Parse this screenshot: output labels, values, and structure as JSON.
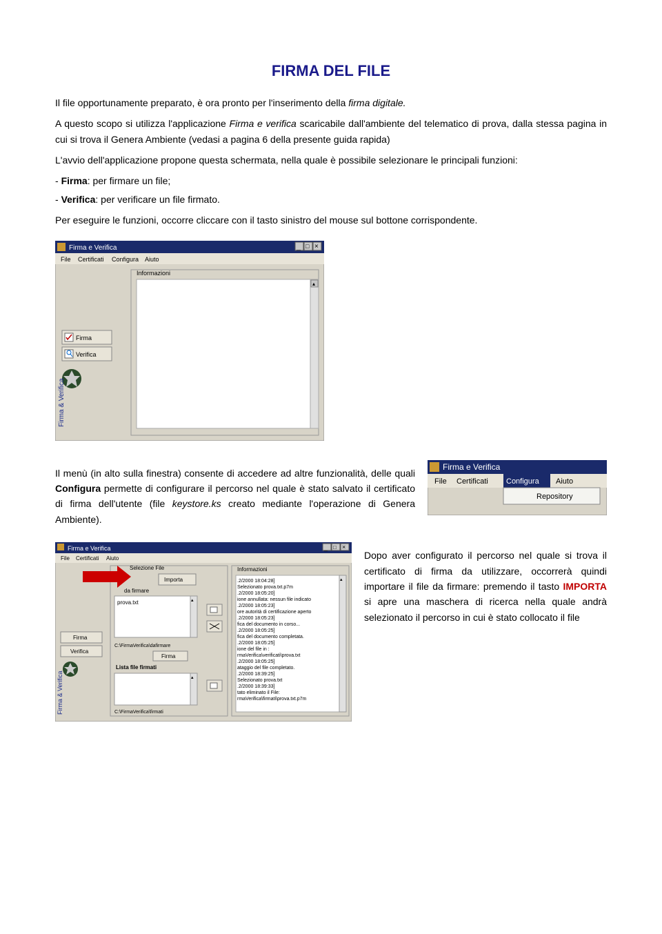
{
  "title": "FIRMA DEL FILE",
  "intro": "Il file opportunamente preparato, è ora pronto per l'inserimento della ",
  "intro_italic": "firma digitale.",
  "p1a": "A questo scopo si utilizza l'applicazione ",
  "p1_italic": "Firma e verifica",
  "p1b": " scaricabile dall'ambiente del telematico di prova, dalla stessa pagina in cui si trova il Genera Ambiente (vedasi a pagina 6 della presente guida rapida)",
  "p2": "L'avvio dell'applicazione propone questa schermata, nella quale è possibile selezionare le principali funzioni:",
  "bullet1_bold": "Firma",
  "bullet1_rest": ": per firmare un file;",
  "bullet2_bold": "Verifica",
  "bullet2_rest": ": per verificare un file firmato.",
  "p3": "Per eseguire le funzioni, occorre cliccare con il tasto sinistro del mouse sul bottone corrispondente.",
  "menu_p_a": "Il menù (in alto sulla finestra) consente di accedere ad altre funzionalità, delle quali ",
  "menu_p_bold": "Configura",
  "menu_p_b": " permette di configurare il percorso nel quale è stato salvato il certificato di firma dell'utente (file ",
  "menu_p_italic": "keystore.ks",
  "menu_p_c": " creato mediante l'operazione di Genera Ambiente).",
  "final_a": "Dopo aver configurato il percorso nel quale si trova il certificato di firma da utilizzare, occorrerà quindi importare il file da firmare: premendo il tasto ",
  "final_red": "IMPORTA",
  "final_b": " si apre una maschera di ricerca nella quale andrà selezionato il percorso in cui è stato collocato il file",
  "app_window": {
    "title": "Firma e Verifica",
    "menu": [
      "File",
      "Certificati",
      "Configura",
      "Aiuto"
    ],
    "panel": "Informazioni",
    "btn_firma": "Firma",
    "btn_verifica": "Verifica",
    "vertical_label": "Firma & Verifica"
  },
  "menu_window": {
    "title": "Firma e Verifica",
    "menu": [
      "File",
      "Certificati",
      "Configura",
      "Aiuto"
    ],
    "submenu": "Repository"
  },
  "shot2": {
    "title": "Firma e Verifica",
    "menu": [
      "File",
      "Certificati",
      "Aiuto"
    ],
    "selezione_file": "Selezione File",
    "importa": "Importa",
    "da_firmare": "da firmare",
    "file_entry": "prova.txt",
    "path1": "C:\\FirmaVerifica\\dafirmare",
    "firma_btn": "Firma",
    "lista_firmati": "Lista file firmati",
    "path2": "C:\\FirmaVerifica\\firmati",
    "btn_firma": "Firma",
    "btn_verifica": "Verifica",
    "panel": "Informazioni",
    "loglines": [
      ".2/2000 18:04:28]",
      " Selezionato prova.txt.p7m",
      ".2/2000 18:05:20]",
      "ione annullata: nessun file indicato",
      ".2/2000 18:05:23]",
      "ore autorità di certificazione aperto",
      ".2/2000 18:05:23]",
      "fica del documento in corso...",
      ".2/2000 18:05:25]",
      "fica del documento completata.",
      ".2/2000 18:05:25]",
      "ione del file in :",
      "rmaVerifica\\verificati\\prova.txt",
      ".2/2000 18:05:25]",
      "ataggio del file completato.",
      ".2/2000 18:39:25]",
      " Selezionato prova.txt",
      ".2/2000 18:39:33]",
      "tato eliminato il File:",
      "rmaVerifica\\firmati\\prova.txt.p7m"
    ],
    "vertical_label": "Firma & Verifica"
  }
}
